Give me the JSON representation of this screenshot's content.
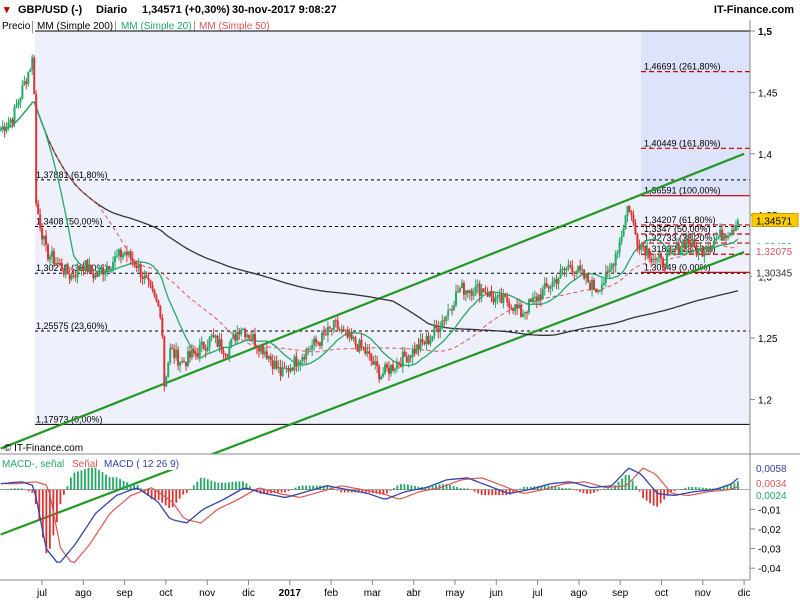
{
  "header": {
    "title": "GBP/USD (-)",
    "period": "Diario",
    "quote": "1,34571 (+0,30%)",
    "datetime": "30-nov-2017 9:08:27",
    "brand": "IT-Finance.com"
  },
  "legend": [
    {
      "label": "Precio",
      "color": "#000000"
    },
    {
      "label": "MM (Simple 200)",
      "color": "#333333"
    },
    {
      "label": "MM (Simple 20)",
      "color": "#22aa66"
    },
    {
      "label": "MM (Simple 50)",
      "color": "#dd5555"
    }
  ],
  "watermark": "© IT-Finance.com",
  "macd_legend": [
    {
      "label": "MACD-, señal",
      "color": "#22aa66"
    },
    {
      "label": "Señal",
      "color": "#dd5555"
    },
    {
      "label": "MACD ( 12 26 9)",
      "color": "#3344aa"
    }
  ],
  "colors": {
    "background": "#eef0fb",
    "channel": "#229922",
    "fib": "#000000",
    "fib_proj": "#cc0000",
    "badge": "#ffcc00"
  },
  "chart_data": [
    {
      "type": "candlestick",
      "ylim": [
        1.18,
        1.5
      ],
      "y_ticks": [
        {
          "value": 1.5,
          "label": "1,5"
        },
        {
          "value": 1.45,
          "label": "1,45"
        },
        {
          "value": 1.4,
          "label": "1,4"
        },
        {
          "value": 1.35,
          "label": "1,35"
        },
        {
          "value": 1.3,
          "label": "1,3"
        },
        {
          "value": 1.25,
          "label": "1,25"
        },
        {
          "value": 1.2,
          "label": "1,2"
        }
      ],
      "x_months": [
        {
          "label": "jul",
          "m": 0.2
        },
        {
          "label": "ago",
          "m": 1.2
        },
        {
          "label": "sep",
          "m": 2.2
        },
        {
          "label": "oct",
          "m": 3.2
        },
        {
          "label": "nov",
          "m": 4.2
        },
        {
          "label": "dic",
          "m": 5.2
        },
        {
          "label": "2017",
          "m": 6.2,
          "bold": true
        },
        {
          "label": "feb",
          "m": 7.2
        },
        {
          "label": "mar",
          "m": 8.2
        },
        {
          "label": "abr",
          "m": 9.2
        },
        {
          "label": "may",
          "m": 10.2
        },
        {
          "label": "jun",
          "m": 11.2
        },
        {
          "label": "jul",
          "m": 12.2
        },
        {
          "label": "ago",
          "m": 13.2
        },
        {
          "label": "sep",
          "m": 14.2
        },
        {
          "label": "oct",
          "m": 15.2
        },
        {
          "label": "nov",
          "m": 16.2
        },
        {
          "label": "dic",
          "m": 17.2
        }
      ],
      "close_anchors": [
        [
          -0.8,
          1.42
        ],
        [
          -0.5,
          1.43
        ],
        [
          -0.2,
          1.46
        ],
        [
          0.0,
          1.48
        ],
        [
          0.05,
          1.36
        ],
        [
          0.3,
          1.32
        ],
        [
          0.6,
          1.31
        ],
        [
          0.9,
          1.3
        ],
        [
          1.2,
          1.31
        ],
        [
          1.5,
          1.3
        ],
        [
          1.8,
          1.31
        ],
        [
          2.2,
          1.32
        ],
        [
          2.5,
          1.31
        ],
        [
          2.8,
          1.29
        ],
        [
          3.1,
          1.27
        ],
        [
          3.15,
          1.21
        ],
        [
          3.3,
          1.24
        ],
        [
          3.6,
          1.23
        ],
        [
          4.0,
          1.24
        ],
        [
          4.3,
          1.25
        ],
        [
          4.7,
          1.24
        ],
        [
          5.0,
          1.26
        ],
        [
          5.3,
          1.25
        ],
        [
          5.6,
          1.24
        ],
        [
          6.0,
          1.22
        ],
        [
          6.3,
          1.23
        ],
        [
          6.6,
          1.24
        ],
        [
          7.0,
          1.25
        ],
        [
          7.3,
          1.26
        ],
        [
          7.6,
          1.25
        ],
        [
          8.0,
          1.24
        ],
        [
          8.4,
          1.22
        ],
        [
          8.8,
          1.23
        ],
        [
          9.2,
          1.24
        ],
        [
          9.6,
          1.25
        ],
        [
          10.0,
          1.27
        ],
        [
          10.3,
          1.29
        ],
        [
          10.6,
          1.29
        ],
        [
          10.9,
          1.29
        ],
        [
          11.2,
          1.28
        ],
        [
          11.5,
          1.28
        ],
        [
          11.8,
          1.27
        ],
        [
          12.1,
          1.28
        ],
        [
          12.4,
          1.29
        ],
        [
          12.7,
          1.3
        ],
        [
          13.0,
          1.31
        ],
        [
          13.3,
          1.3
        ],
        [
          13.6,
          1.29
        ],
        [
          13.9,
          1.3
        ],
        [
          14.2,
          1.33
        ],
        [
          14.4,
          1.36
        ],
        [
          14.6,
          1.33
        ],
        [
          14.9,
          1.32
        ],
        [
          15.2,
          1.31
        ],
        [
          15.5,
          1.32
        ],
        [
          15.8,
          1.33
        ],
        [
          16.1,
          1.32
        ],
        [
          16.5,
          1.33
        ],
        [
          16.9,
          1.34
        ],
        [
          17.05,
          1.3457
        ]
      ],
      "channel": [
        {
          "points": [
            [
              -0.8,
              1.16
            ],
            [
              17.2,
              1.4
            ]
          ],
          "name": "upper"
        },
        {
          "points": [
            [
              -0.8,
              1.09
            ],
            [
              17.2,
              1.32
            ]
          ],
          "name": "lower"
        }
      ],
      "fib_retracement": [
        {
          "value": 1.37881,
          "label": "1,37881 (61,80%)"
        },
        {
          "value": 1.3408,
          "label": "1,3408 (50,00%)"
        },
        {
          "value": 1.30278,
          "label": "1,30278 (38,20%)"
        },
        {
          "value": 1.25575,
          "label": "1,25575 (23,60%)"
        },
        {
          "value": 1.17973,
          "label": "1,17973 (0,00%)"
        }
      ],
      "fib_top": {
        "value": 1.5
      },
      "fib_projection": [
        {
          "value": 1.46691,
          "label": "1,46691 (261,80%)"
        },
        {
          "value": 1.40449,
          "label": "1,40449 (161,80%)"
        },
        {
          "value": 1.36591,
          "label": "1,36591 (100,00%)"
        },
        {
          "value": 1.34207,
          "label": "1,34207 (61,80%)"
        },
        {
          "value": 1.3347,
          "label": "1,3347 (50,00%)"
        },
        {
          "value": 1.32733,
          "label": "1,32733 (38,20%)"
        },
        {
          "value": 1.31822,
          "label": "1,31822 (23,60%)"
        },
        {
          "value": 1.30349,
          "label": "1,30349 (0,00%)"
        }
      ],
      "price_badges": [
        {
          "value": 1.34571,
          "label": "1,34571",
          "bg": "#ffcc00",
          "fg": "#000000"
        },
        {
          "value": 1.32486,
          "label": "1,32486",
          "bg": "#ffffff",
          "fg": "#22aa66"
        },
        {
          "value": 1.32075,
          "label": "1,32075",
          "bg": "#ffffff",
          "fg": "#dd5555"
        },
        {
          "value": 1.30345,
          "label": "1,30345",
          "bg": "#ffffff",
          "fg": "#333333"
        }
      ]
    },
    {
      "type": "histogram",
      "name": "MACD",
      "ylim": [
        -0.045,
        0.01
      ],
      "y_ticks": [
        {
          "value": -0.01,
          "label": "-0,01"
        },
        {
          "value": -0.02,
          "label": "-0,02"
        },
        {
          "value": -0.03,
          "label": "-0,03"
        },
        {
          "value": -0.04,
          "label": "-0,04"
        }
      ],
      "macd_anchors": [
        [
          -0.8,
          0.003
        ],
        [
          -0.3,
          0.004
        ],
        [
          0.0,
          0.002
        ],
        [
          0.3,
          -0.03
        ],
        [
          0.6,
          -0.038
        ],
        [
          1.0,
          -0.028
        ],
        [
          1.5,
          -0.012
        ],
        [
          2.0,
          -0.003
        ],
        [
          2.5,
          0.001
        ],
        [
          3.0,
          -0.006
        ],
        [
          3.3,
          -0.015
        ],
        [
          3.7,
          -0.017
        ],
        [
          4.1,
          -0.01
        ],
        [
          4.6,
          -0.005
        ],
        [
          5.1,
          0.001
        ],
        [
          5.6,
          -0.002
        ],
        [
          6.1,
          -0.004
        ],
        [
          6.6,
          -0.001
        ],
        [
          7.1,
          0.002
        ],
        [
          7.6,
          0.0
        ],
        [
          8.1,
          -0.002
        ],
        [
          8.5,
          -0.005
        ],
        [
          9.0,
          -0.001
        ],
        [
          9.5,
          0.001
        ],
        [
          10.0,
          0.005
        ],
        [
          10.5,
          0.006
        ],
        [
          11.0,
          0.002
        ],
        [
          11.5,
          -0.002
        ],
        [
          12.0,
          0.0
        ],
        [
          12.5,
          0.003
        ],
        [
          13.0,
          0.004
        ],
        [
          13.5,
          0.001
        ],
        [
          14.0,
          0.002
        ],
        [
          14.4,
          0.011
        ],
        [
          14.7,
          0.008
        ],
        [
          15.1,
          -0.002
        ],
        [
          15.5,
          -0.003
        ],
        [
          16.0,
          -0.001
        ],
        [
          16.5,
          0.0
        ],
        [
          16.9,
          0.003
        ],
        [
          17.05,
          0.0058
        ]
      ],
      "price_badges": [
        {
          "value": 0.0058,
          "label": "0,0058",
          "fg": "#3344aa"
        },
        {
          "value": 0.0034,
          "label": "0,0034",
          "fg": "#dd5555"
        },
        {
          "value": 0.0024,
          "label": "0,0024",
          "fg": "#22aa66"
        }
      ]
    }
  ]
}
